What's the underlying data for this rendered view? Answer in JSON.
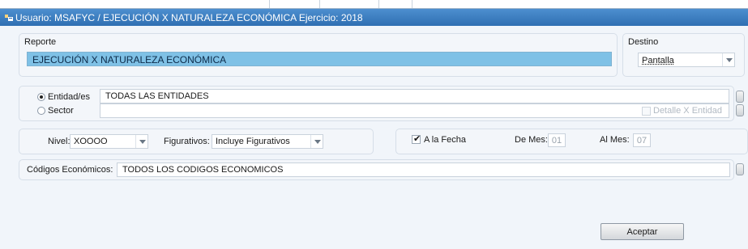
{
  "window": {
    "title": "Usuario: MSAFYC  /  EJECUCIÓN X NATURALEZA ECONÓMICA  Ejercicio: 2018"
  },
  "reporte": {
    "label": "Reporte",
    "value": "EJECUCIÓN X NATURALEZA ECONÓMICA"
  },
  "destino": {
    "label": "Destino",
    "value": "Pantalla"
  },
  "entidad": {
    "label": "Entidad/es",
    "value": "TODAS LAS ENTIDADES",
    "selected": true
  },
  "sector": {
    "label": "Sector",
    "value": "",
    "detalle_label": "Detalle X Entidad",
    "detalle_checked": false,
    "detalle_enabled": false
  },
  "nivel": {
    "label": "Nivel:",
    "value": "XOOOO"
  },
  "figurativos": {
    "label": "Figurativos:",
    "value": "Incluye Figurativos"
  },
  "a_la_fecha": {
    "label": "A la Fecha",
    "checked": true
  },
  "de_mes": {
    "label": "De Mes:",
    "value": "01"
  },
  "al_mes": {
    "label": "Al Mes:",
    "value": "07"
  },
  "codigos": {
    "label": "Códigos Económicos:",
    "value": "TODOS LOS CODIGOS ECONOMICOS"
  },
  "aceptar": {
    "label": "Aceptar"
  },
  "colors": {
    "titlebar": "#3a7cc0",
    "selected_field": "#7fc1e6",
    "window_bg": "#f1f5fa"
  }
}
